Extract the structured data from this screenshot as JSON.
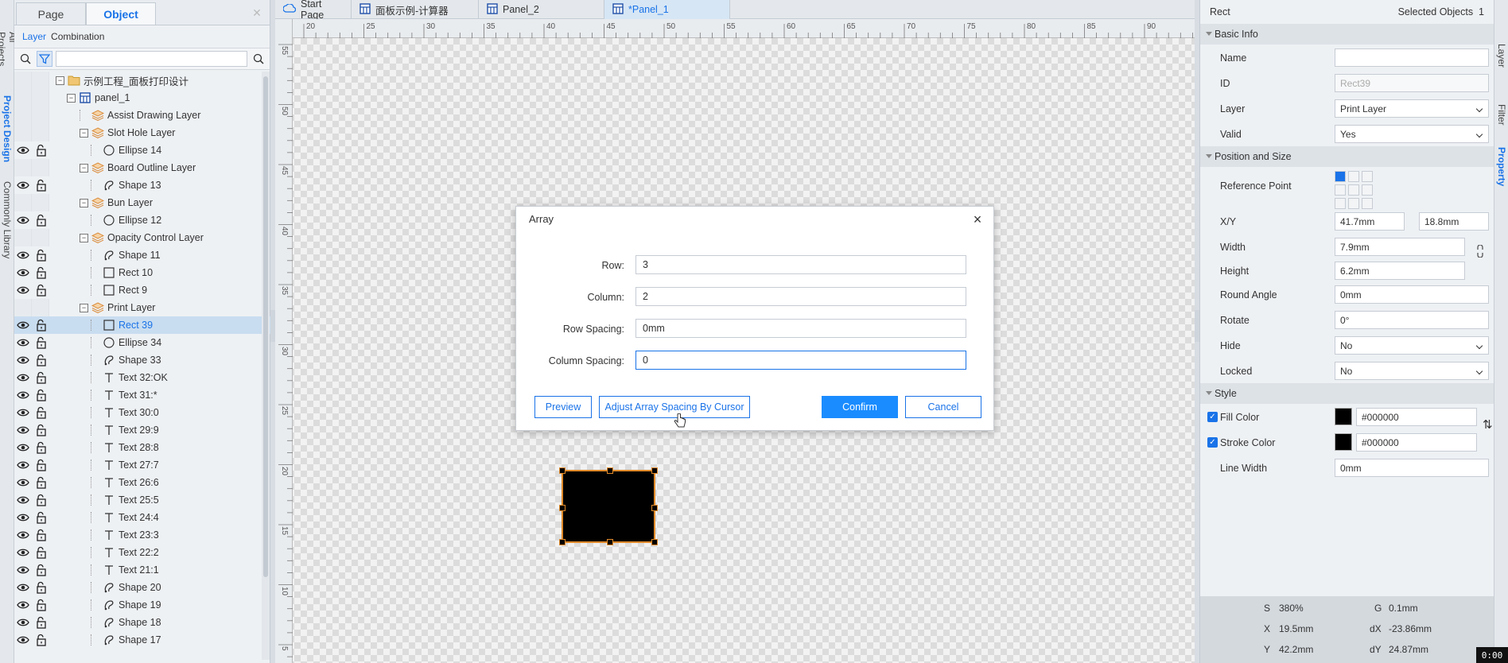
{
  "left_vtabs": [
    "All Projects",
    "Project Design",
    "Commonly Library"
  ],
  "left_panel": {
    "tabs": [
      "Page",
      "Object"
    ],
    "subtabs": [
      "Layer",
      "Combination"
    ],
    "tree": [
      {
        "label": "示例工程_面板打印设计",
        "icon": "folder-icon",
        "level": 0,
        "expander": "−",
        "eye": false
      },
      {
        "label": "panel_1",
        "icon": "panel-icon",
        "level": 1,
        "expander": "−",
        "eye": false
      },
      {
        "label": "Assist Drawing Layer",
        "icon": "layer-icon",
        "level": 2,
        "expander": "",
        "eye": false
      },
      {
        "label": "Slot Hole Layer",
        "icon": "layer-icon",
        "level": 2,
        "expander": "−",
        "eye": false
      },
      {
        "label": "Ellipse 14",
        "icon": "ellipse-icon",
        "level": 3,
        "expander": "",
        "eye": true
      },
      {
        "label": "Board Outline Layer",
        "icon": "layer-icon",
        "level": 2,
        "expander": "−",
        "eye": false
      },
      {
        "label": "Shape 13",
        "icon": "shape-icon",
        "level": 3,
        "expander": "",
        "eye": true
      },
      {
        "label": "Bun Layer",
        "icon": "layer-icon",
        "level": 2,
        "expander": "−",
        "eye": false
      },
      {
        "label": "Ellipse 12",
        "icon": "ellipse-icon",
        "level": 3,
        "expander": "",
        "eye": true
      },
      {
        "label": "Opacity Control Layer",
        "icon": "layer-icon",
        "level": 2,
        "expander": "−",
        "eye": false
      },
      {
        "label": "Shape 11",
        "icon": "shape-icon",
        "level": 3,
        "expander": "",
        "eye": true
      },
      {
        "label": "Rect 10",
        "icon": "rect-icon",
        "level": 3,
        "expander": "",
        "eye": true
      },
      {
        "label": "Rect 9",
        "icon": "rect-icon",
        "level": 3,
        "expander": "",
        "eye": true
      },
      {
        "label": "Print Layer",
        "icon": "layer-icon",
        "level": 2,
        "expander": "−",
        "eye": false
      },
      {
        "label": "Rect 39",
        "icon": "rect-icon",
        "level": 3,
        "expander": "",
        "eye": true,
        "selected": true
      },
      {
        "label": "Ellipse 34",
        "icon": "ellipse-icon",
        "level": 3,
        "expander": "",
        "eye": true
      },
      {
        "label": "Shape 33",
        "icon": "shape-icon",
        "level": 3,
        "expander": "",
        "eye": true
      },
      {
        "label": "Text 32:OK",
        "icon": "text-icon",
        "level": 3,
        "expander": "",
        "eye": true
      },
      {
        "label": "Text 31:*",
        "icon": "text-icon",
        "level": 3,
        "expander": "",
        "eye": true
      },
      {
        "label": "Text 30:0",
        "icon": "text-icon",
        "level": 3,
        "expander": "",
        "eye": true
      },
      {
        "label": "Text 29:9",
        "icon": "text-icon",
        "level": 3,
        "expander": "",
        "eye": true
      },
      {
        "label": "Text 28:8",
        "icon": "text-icon",
        "level": 3,
        "expander": "",
        "eye": true
      },
      {
        "label": "Text 27:7",
        "icon": "text-icon",
        "level": 3,
        "expander": "",
        "eye": true
      },
      {
        "label": "Text 26:6",
        "icon": "text-icon",
        "level": 3,
        "expander": "",
        "eye": true
      },
      {
        "label": "Text 25:5",
        "icon": "text-icon",
        "level": 3,
        "expander": "",
        "eye": true
      },
      {
        "label": "Text 24:4",
        "icon": "text-icon",
        "level": 3,
        "expander": "",
        "eye": true
      },
      {
        "label": "Text 23:3",
        "icon": "text-icon",
        "level": 3,
        "expander": "",
        "eye": true
      },
      {
        "label": "Text 22:2",
        "icon": "text-icon",
        "level": 3,
        "expander": "",
        "eye": true
      },
      {
        "label": "Text 21:1",
        "icon": "text-icon",
        "level": 3,
        "expander": "",
        "eye": true
      },
      {
        "label": "Shape 20",
        "icon": "shape-icon",
        "level": 3,
        "expander": "",
        "eye": true
      },
      {
        "label": "Shape 19",
        "icon": "shape-icon",
        "level": 3,
        "expander": "",
        "eye": true
      },
      {
        "label": "Shape 18",
        "icon": "shape-icon",
        "level": 3,
        "expander": "",
        "eye": true
      },
      {
        "label": "Shape 17",
        "icon": "shape-icon",
        "level": 3,
        "expander": "",
        "eye": true
      }
    ]
  },
  "doc_tabs": [
    {
      "label": "Start Page",
      "icon": "start-page-icon",
      "active": false
    },
    {
      "label": "面板示例-计算器",
      "icon": "panel-icon",
      "active": false
    },
    {
      "label": "Panel_2",
      "icon": "panel-icon",
      "active": false
    },
    {
      "label": "*Panel_1",
      "icon": "panel-icon",
      "active": true
    }
  ],
  "rulers": {
    "h_ticks": [
      "20",
      "25",
      "30",
      "35",
      "40",
      "45",
      "50",
      "55",
      "60",
      "65",
      "70",
      "75",
      "80",
      "85",
      "90"
    ],
    "v_ticks": [
      "55",
      "50",
      "45",
      "40",
      "35",
      "30",
      "25",
      "20",
      "15",
      "10",
      "5"
    ]
  },
  "dialog": {
    "title": "Array",
    "fields": [
      {
        "label": "Row:",
        "value": "3"
      },
      {
        "label": "Column:",
        "value": "2"
      },
      {
        "label": "Row Spacing:",
        "value": "0mm"
      },
      {
        "label": "Column Spacing:",
        "value": "0"
      }
    ],
    "buttons": {
      "preview": "Preview",
      "adjust": "Adjust Array Spacing By Cursor",
      "confirm": "Confirm",
      "cancel": "Cancel"
    }
  },
  "right_panel": {
    "object_type": "Rect",
    "selected_label": "Selected Objects",
    "selected_count": "1",
    "sections": {
      "basic": "Basic Info",
      "position": "Position and Size",
      "style": "Style"
    },
    "basic": [
      {
        "label": "Name",
        "value": "",
        "kind": "input"
      },
      {
        "label": "ID",
        "value": "Rect39",
        "kind": "disabled"
      },
      {
        "label": "Layer",
        "value": "Print Layer",
        "kind": "select"
      },
      {
        "label": "Valid",
        "value": "Yes",
        "kind": "select"
      }
    ],
    "reference_point_label": "Reference Point",
    "xy_label": "X/Y",
    "x_value": "41.7mm",
    "y_value": "18.8mm",
    "width_label": "Width",
    "width_value": "7.9mm",
    "height_label": "Height",
    "height_value": "6.2mm",
    "position_rest": [
      {
        "label": "Round Angle",
        "value": "0mm",
        "kind": "input"
      },
      {
        "label": "Rotate",
        "value": "0°",
        "kind": "input"
      },
      {
        "label": "Hide",
        "value": "No",
        "kind": "select"
      },
      {
        "label": "Locked",
        "value": "No",
        "kind": "select"
      }
    ],
    "fill_color_label": "Fill Color",
    "fill_color_value": "#000000",
    "stroke_color_label": "Stroke Color",
    "stroke_color_value": "#000000",
    "line_width_label": "Line Width",
    "line_width_value": "0mm",
    "status": {
      "s_label": "S",
      "s_value": "380%",
      "g_label": "G",
      "g_value": "0.1mm",
      "x_label": "X",
      "x_value": "19.5mm",
      "dx_label": "dX",
      "dx_value": "-23.86mm",
      "y_label": "Y",
      "y_value": "42.2mm",
      "dy_label": "dY",
      "dy_value": "24.87mm"
    }
  },
  "right_vtabs": [
    "Layer",
    "Filter",
    "Property"
  ],
  "timer": "0:00",
  "colors": {
    "accent": "#1a73e8",
    "selection_border": "#e08a2a",
    "fill": "#000000"
  }
}
